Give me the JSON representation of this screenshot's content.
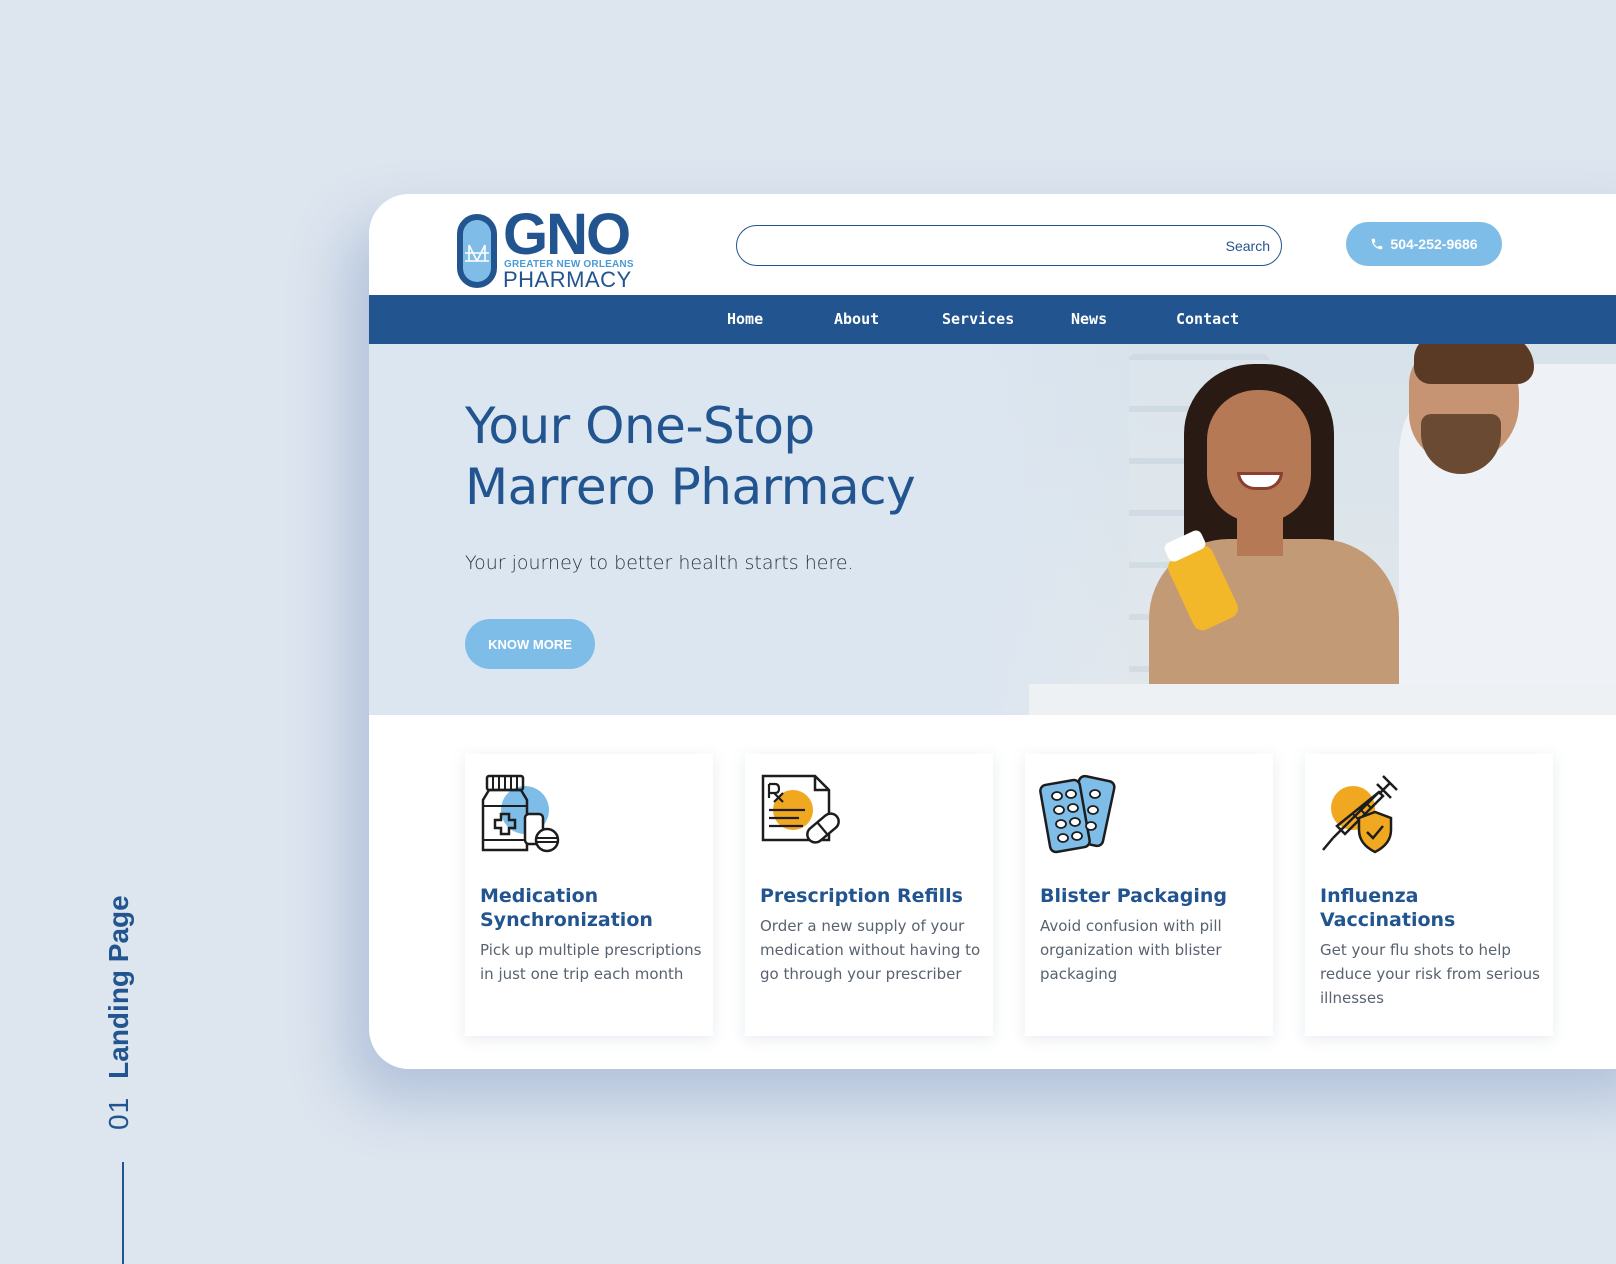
{
  "caption": {
    "number": "01",
    "label": "Landing Page"
  },
  "logo": {
    "main": "GNO",
    "sub": "GREATER NEW ORLEANS",
    "pharmacy": "PHARMACY"
  },
  "search": {
    "button_label": "Search",
    "value": "",
    "placeholder": ""
  },
  "phone": {
    "number": "504-252-9686"
  },
  "nav": {
    "items": [
      {
        "label": "Home"
      },
      {
        "label": "About"
      },
      {
        "label": "Services"
      },
      {
        "label": "News"
      },
      {
        "label": "Contact"
      }
    ]
  },
  "hero": {
    "title_line1": "Your One-Stop",
    "title_line2": "Marrero Pharmacy",
    "subtitle": "Your journey to better health starts here.",
    "button_label": "KNOW MORE"
  },
  "cards": [
    {
      "title": "Medication Synchronization",
      "description": "Pick up multiple prescriptions in just one trip each month",
      "icon": "medicine-bottle-icon"
    },
    {
      "title": "Prescription Refills",
      "description": "Order a new supply of your medication  without having to go through your prescriber",
      "icon": "prescription-icon"
    },
    {
      "title": "Blister Packaging",
      "description": "Avoid confusion with pill organization with blister packaging",
      "icon": "blister-pack-icon"
    },
    {
      "title": "Influenza Vaccinations",
      "description": "Get your flu shots to help reduce your risk from serious illnesses",
      "icon": "syringe-shield-icon"
    }
  ],
  "colors": {
    "brand_blue": "#22558f",
    "light_blue": "#7fbde9",
    "accent_orange": "#f0a820",
    "page_bg": "#dde5ef",
    "hero_bg": "#dce6f1"
  }
}
